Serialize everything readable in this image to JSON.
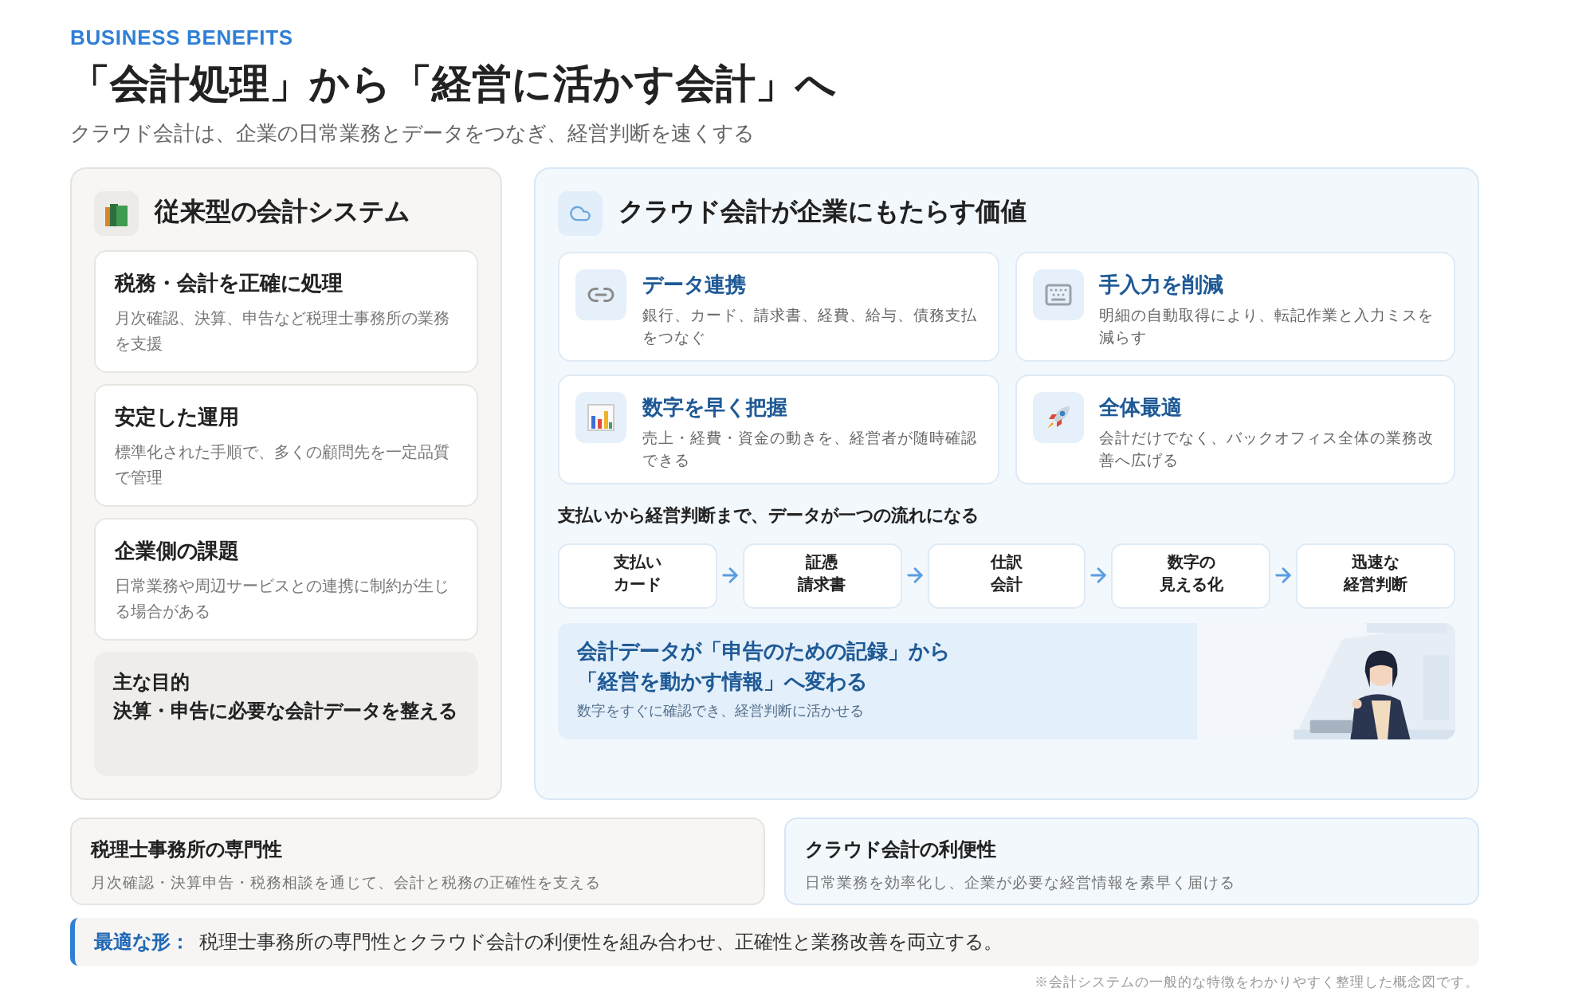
{
  "eyebrow": "BUSINESS BENEFITS",
  "title": "「会計処理」から「経営に活かす会計」へ",
  "subtitle": "クラウド会計は、企業の日常業務とデータをつなぎ、経営判断を速くする",
  "legacy": {
    "title": "従来型の会計システム",
    "cards": [
      {
        "title": "税務・会計を正確に処理",
        "text": "月次確認、決算、申告など税理士事務所の業務を支援"
      },
      {
        "title": "安定した運用",
        "text": "標準化された手順で、多くの顧問先を一定品質で管理"
      },
      {
        "title": "企業側の課題",
        "text": "日常業務や周辺サービスとの連携に制約が生じる場合がある"
      }
    ],
    "goal": {
      "label": "主な目的",
      "text": "決算・申告に必要な会計データを整える"
    }
  },
  "cloud": {
    "title": "クラウド会計が企業にもたらす価値",
    "features": [
      {
        "kind": "link",
        "title": "データ連携",
        "text": "銀行、カード、請求書、経費、給与、債務支払をつなぐ"
      },
      {
        "kind": "keyboard",
        "title": "手入力を削減",
        "text": "明細の自動取得により、転記作業と入力ミスを減らす"
      },
      {
        "kind": "chart",
        "title": "数字を早く把握",
        "text": "売上・経費・資金の動きを、経営者が随時確認できる"
      },
      {
        "kind": "rocket",
        "title": "全体最適",
        "text": "会計だけでなく、バックオフィス全体の業務改善へ広げる"
      }
    ],
    "flow_title": "支払いから経営判断まで、データが一つの流れになる",
    "flow": [
      {
        "line1": "支払い",
        "line2": "カード"
      },
      {
        "line1": "証憑",
        "line2": "請求書"
      },
      {
        "line1": "仕訳",
        "line2": "会計"
      },
      {
        "line1": "数字の",
        "line2": "見える化"
      },
      {
        "line1": "迅速な",
        "line2": "経営判断"
      }
    ],
    "banner": {
      "line1": "会計データが「申告のための記録」から",
      "line2": "「経営を動かす情報」へ変わる",
      "caption": "数字をすぐに確認でき、経営判断に活かせる",
      "kind": "picture"
    }
  },
  "strengths": [
    {
      "kind": "firm",
      "title": "税理士事務所の専門性",
      "text": "月次確認・決算申告・税務相談を通じて、会計と税務の正確性を支える"
    },
    {
      "kind": "cloud",
      "title": "クラウド会計の利便性",
      "text": "日常業務を効率化し、企業が必要な経営情報を素早く届ける"
    }
  ],
  "conclusion": {
    "label": "最適な形：",
    "text": "税理士事務所の専門性とクラウド会計の利便性を組み合わせ、正確性と業務改善を両立する。"
  },
  "footnote": "※会計システムの一般的な特徴をわかりやすく整理した概念図です。"
}
